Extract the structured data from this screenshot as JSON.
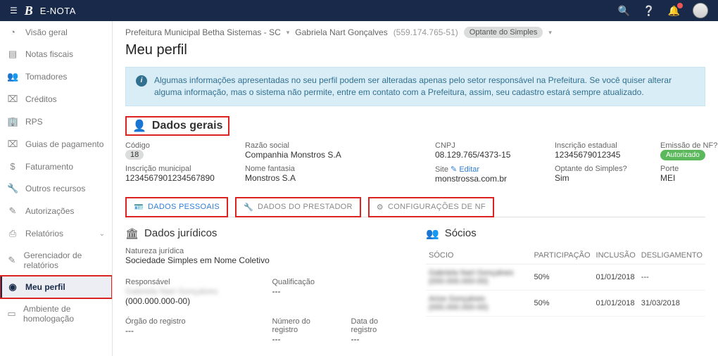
{
  "brand": {
    "letter": "B",
    "name": "E-NOTA"
  },
  "breadcrumb": {
    "org": "Prefeitura Municipal Betha Sistemas - SC",
    "user": "Gabriela Nart Gonçalves",
    "user_doc": "(559.174.765-51)",
    "badge": "Optante do Simples"
  },
  "page_title": "Meu perfil",
  "info_message": "Algumas informações apresentadas no seu perfil podem ser alteradas apenas pelo setor responsável na Prefeitura. Se você quiser alterar alguma informação, mas o sistema não permite, entre em contato com a Prefeitura, assim, seu cadastro estará sempre atualizado.",
  "sidebar": {
    "items": [
      {
        "icon": "◔",
        "label": "Visão geral"
      },
      {
        "icon": "▤",
        "label": "Notas fiscais"
      },
      {
        "icon": "👥",
        "label": "Tomadores"
      },
      {
        "icon": "⌧",
        "label": "Créditos"
      },
      {
        "icon": "🏢",
        "label": "RPS"
      },
      {
        "icon": "⌧",
        "label": "Guias de pagamento"
      },
      {
        "icon": "$",
        "label": "Faturamento"
      },
      {
        "icon": "🔧",
        "label": "Outros recursos"
      },
      {
        "icon": "✎",
        "label": "Autorizações"
      },
      {
        "icon": "⎙",
        "label": "Relatórios",
        "expandable": true
      },
      {
        "icon": "✎",
        "label": "Gerenciador de relatórios"
      },
      {
        "icon": "◉",
        "label": "Meu perfil",
        "active": true,
        "highlighted": true
      },
      {
        "icon": "▭",
        "label": "Ambiente de homologação"
      }
    ]
  },
  "dados_gerais_title": "Dados gerais",
  "fields": {
    "codigo_label": "Código",
    "codigo_value": "18",
    "razao_label": "Razão social",
    "razao_value": "Companhia Monstros S.A",
    "cnpj_label": "CNPJ",
    "cnpj_value": "08.129.765/4373-15",
    "ie_label": "Inscrição estadual",
    "ie_value": "12345679012345",
    "nf_label": "Emissão de NF?",
    "nf_value": "Autorizado",
    "im_label": "Inscrição municipal",
    "im_value": "1234567901234567890",
    "fantasia_label": "Nome fantasia",
    "fantasia_value": "Monstros S.A",
    "site_label": "Site",
    "site_value": "monstrossa.com.br",
    "site_edit": "Editar",
    "simples_label": "Optante do Simples?",
    "simples_value": "Sim",
    "porte_label": "Porte",
    "porte_value": "MEI"
  },
  "tabs": {
    "pessoais": "DADOS PESSOAIS",
    "prestador": "DADOS DO PRESTADOR",
    "config": "CONFIGURAÇÕES DE NF"
  },
  "juridicos": {
    "title": "Dados jurídicos",
    "natureza_label": "Natureza jurídica",
    "natureza_value": "Sociedade Simples em Nome Coletivo",
    "resp_label": "Responsável",
    "resp_name": "Gabriela Nart Gonçalves",
    "resp_doc": "(000.000.000-00)",
    "qual_label": "Qualificação",
    "qual_value": "---",
    "orgao_label": "Órgão do registro",
    "orgao_value": "---",
    "num_label": "Número do registro",
    "num_value": "---",
    "data_label": "Data do registro",
    "data_value": "---"
  },
  "socios": {
    "title": "Sócios",
    "headers": {
      "socio": "SÓCIO",
      "part": "PARTICIPAÇÃO",
      "inc": "INCLUSÃO",
      "des": "DESLIGAMENTO"
    },
    "rows": [
      {
        "name": "Gabriela Nart Gonçalves (000.000.000-00)",
        "part": "50%",
        "inc": "01/01/2018",
        "des": "---"
      },
      {
        "name": "Arize Gonçalves (000.000.000-00)",
        "part": "50%",
        "inc": "01/01/2018",
        "des": "31/03/2018"
      }
    ]
  }
}
